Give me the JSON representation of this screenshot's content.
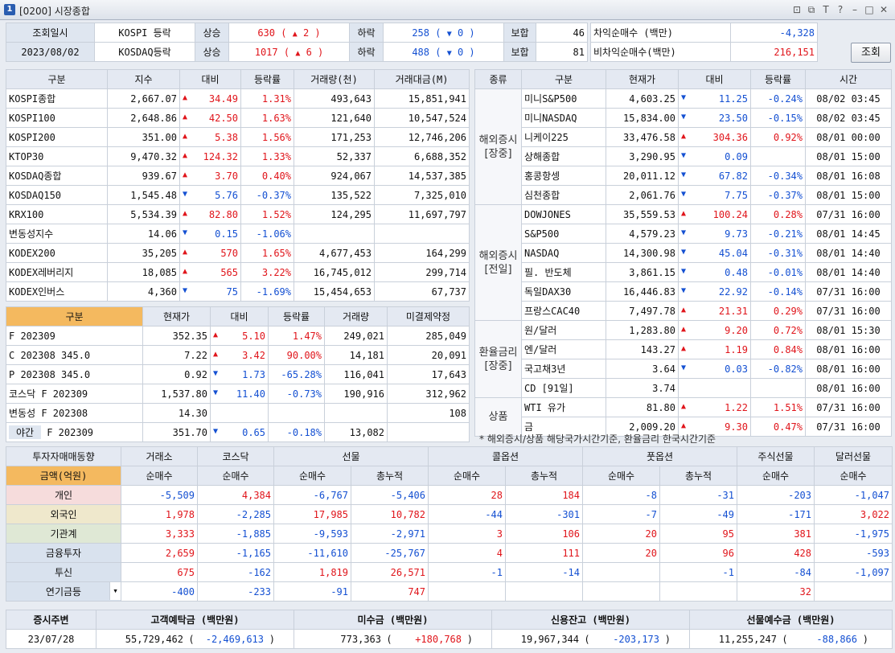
{
  "window": {
    "title": "[0200] 시장종합",
    "app_icon": "1"
  },
  "topbar": {
    "query_date_label": "조회일시",
    "query_date": "2023/08/02",
    "rows": [
      {
        "name": "KOSPI 등락",
        "up_label": "상승",
        "up": "630",
        "up_lim": "2",
        "down_label": "하락",
        "down": "258",
        "down_lim": "0",
        "flat_label": "보합",
        "flat": "46"
      },
      {
        "name": "KOSDAQ등락",
        "up_label": "상승",
        "up": "1017",
        "up_lim": "6",
        "down_label": "하락",
        "down": "488",
        "down_lim": "0",
        "flat_label": "보합",
        "flat": "81"
      }
    ],
    "arb": [
      {
        "label": "차익순매수 (백만)",
        "value": "-4,328"
      },
      {
        "label": "비차익순매수(백만)",
        "value": "216,151"
      }
    ],
    "search_button": "조회"
  },
  "domestic": {
    "headers": [
      "구분",
      "지수",
      "대비",
      "등락률",
      "거래량(천)",
      "거래대금(M)"
    ],
    "rows": [
      {
        "name": "KOSPI종합",
        "index": "2,667.07",
        "dir": "up",
        "chg": "34.49",
        "rate": "1.31%",
        "vol": "493,643",
        "amt": "15,851,941"
      },
      {
        "name": "KOSPI100",
        "index": "2,648.86",
        "dir": "up",
        "chg": "42.50",
        "rate": "1.63%",
        "vol": "121,640",
        "amt": "10,547,524"
      },
      {
        "name": "KOSPI200",
        "index": "351.00",
        "dir": "up",
        "chg": "5.38",
        "rate": "1.56%",
        "vol": "171,253",
        "amt": "12,746,206"
      },
      {
        "name": "KTOP30",
        "index": "9,470.32",
        "dir": "up",
        "chg": "124.32",
        "rate": "1.33%",
        "vol": "52,337",
        "amt": "6,688,352"
      },
      {
        "name": "KOSDAQ종합",
        "index": "939.67",
        "dir": "up",
        "chg": "3.70",
        "rate": "0.40%",
        "vol": "924,067",
        "amt": "14,537,385"
      },
      {
        "name": "KOSDAQ150",
        "index": "1,545.48",
        "dir": "dn",
        "chg": "5.76",
        "rate": "-0.37%",
        "vol": "135,522",
        "amt": "7,325,010"
      },
      {
        "name": "KRX100",
        "index": "5,534.39",
        "dir": "up",
        "chg": "82.80",
        "rate": "1.52%",
        "vol": "124,295",
        "amt": "11,697,797"
      },
      {
        "name": "변동성지수",
        "index": "14.06",
        "dir": "dn",
        "chg": "0.15",
        "rate": "-1.06%",
        "vol": "",
        "amt": ""
      },
      {
        "name": "KODEX200",
        "index": "35,205",
        "dir": "up",
        "chg": "570",
        "rate": "1.65%",
        "vol": "4,677,453",
        "amt": "164,299"
      },
      {
        "name": "KODEX레버리지",
        "index": "18,085",
        "dir": "up",
        "chg": "565",
        "rate": "3.22%",
        "vol": "16,745,012",
        "amt": "299,714"
      },
      {
        "name": "KODEX인버스",
        "index": "4,360",
        "dir": "dn",
        "chg": "75",
        "rate": "-1.69%",
        "vol": "15,454,653",
        "amt": "67,737"
      }
    ]
  },
  "futures": {
    "headers": [
      "구분",
      "현재가",
      "대비",
      "등락률",
      "거래량",
      "미결제약정"
    ],
    "rows": [
      {
        "name": "F 202309",
        "price": "352.35",
        "dir": "up",
        "chg": "5.10",
        "rate": "1.47%",
        "vol": "249,021",
        "oi": "285,049"
      },
      {
        "name": "C 202308 345.0",
        "price": "7.22",
        "dir": "up",
        "chg": "3.42",
        "rate": "90.00%",
        "vol": "14,181",
        "oi": "20,091"
      },
      {
        "name": "P 202308 345.0",
        "price": "0.92",
        "dir": "dn",
        "chg": "1.73",
        "rate": "-65.28%",
        "vol": "116,041",
        "oi": "17,643"
      },
      {
        "name": "코스닥 F 202309",
        "price": "1,537.80",
        "dir": "dn",
        "chg": "11.40",
        "rate": "-0.73%",
        "vol": "190,916",
        "oi": "312,962"
      },
      {
        "name": "변동성 F 202308",
        "price": "14.30",
        "dir": "",
        "chg": "",
        "rate": "",
        "vol": "",
        "oi": "108"
      }
    ],
    "night": {
      "label": "야간",
      "name": "F 202309",
      "price": "351.70",
      "dir": "dn",
      "chg": "0.65",
      "rate": "-0.18%",
      "vol": "13,082"
    }
  },
  "world": {
    "headers": [
      "종류",
      "구분",
      "현재가",
      "대비",
      "등락률",
      "시간"
    ],
    "groups": [
      {
        "cat": "해외증시[장중]",
        "rows": [
          {
            "name": "미니S&P500",
            "price": "4,603.25",
            "dir": "dn",
            "chg": "11.25",
            "rate": "-0.24%",
            "time": "08/02 03:45"
          },
          {
            "name": "미니NASDAQ",
            "price": "15,834.00",
            "dir": "dn",
            "chg": "23.50",
            "rate": "-0.15%",
            "time": "08/02 03:45"
          },
          {
            "name": "니케이225",
            "price": "33,476.58",
            "dir": "up",
            "chg": "304.36",
            "rate": "0.92%",
            "time": "08/01 00:00"
          },
          {
            "name": "상해종합",
            "price": "3,290.95",
            "dir": "dn",
            "chg": "0.09",
            "rate": "",
            "time": "08/01 15:00"
          },
          {
            "name": "홍콩항셍",
            "price": "20,011.12",
            "dir": "dn",
            "chg": "67.82",
            "rate": "-0.34%",
            "time": "08/01 16:08"
          },
          {
            "name": "심천종합",
            "price": "2,061.76",
            "dir": "dn",
            "chg": "7.75",
            "rate": "-0.37%",
            "time": "08/01 15:00"
          }
        ]
      },
      {
        "cat": "해외증시[전일]",
        "rows": [
          {
            "name": "DOWJONES",
            "price": "35,559.53",
            "dir": "up",
            "chg": "100.24",
            "rate": "0.28%",
            "time": "07/31 16:00"
          },
          {
            "name": "S&P500",
            "price": "4,579.23",
            "dir": "dn",
            "chg": "9.73",
            "rate": "-0.21%",
            "time": "08/01 14:45"
          },
          {
            "name": "NASDAQ",
            "price": "14,300.98",
            "dir": "dn",
            "chg": "45.04",
            "rate": "-0.31%",
            "time": "08/01 14:40"
          },
          {
            "name": "필. 반도체",
            "price": "3,861.15",
            "dir": "dn",
            "chg": "0.48",
            "rate": "-0.01%",
            "time": "08/01 14:40"
          },
          {
            "name": "독일DAX30",
            "price": "16,446.83",
            "dir": "dn",
            "chg": "22.92",
            "rate": "-0.14%",
            "time": "07/31 16:00"
          },
          {
            "name": "프랑스CAC40",
            "price": "7,497.78",
            "dir": "up",
            "chg": "21.31",
            "rate": "0.29%",
            "time": "07/31 16:00"
          }
        ]
      },
      {
        "cat": "환율금리[장중]",
        "rows": [
          {
            "name": "원/달러",
            "price": "1,283.80",
            "dir": "up",
            "chg": "9.20",
            "rate": "0.72%",
            "time": "08/01 15:30"
          },
          {
            "name": "엔/달러",
            "price": "143.27",
            "dir": "up",
            "chg": "1.19",
            "rate": "0.84%",
            "time": "08/01 16:00"
          },
          {
            "name": "국고채3년",
            "price": "3.64",
            "dir": "dn",
            "chg": "0.03",
            "rate": "-0.82%",
            "time": "08/01 16:00"
          },
          {
            "name": "CD [91일]",
            "price": "3.74",
            "dir": "",
            "chg": "",
            "rate": "",
            "time": "08/01 16:00"
          }
        ]
      },
      {
        "cat": "상품",
        "rows": [
          {
            "name": "WTI 유가",
            "price": "81.80",
            "dir": "up",
            "chg": "1.22",
            "rate": "1.51%",
            "time": "07/31 16:00"
          },
          {
            "name": "금",
            "price": "2,009.20",
            "dir": "up",
            "chg": "9.30",
            "rate": "0.47%",
            "time": "07/31 16:00"
          }
        ]
      }
    ],
    "note": "* 해외증시/상품 해당국가시간기준, 환율금리 한국시간기준"
  },
  "investor": {
    "title": "투자자매매동향",
    "unit": "금액(억원)",
    "groups": [
      "거래소",
      "코스닥",
      "선물",
      "콜옵션",
      "풋옵션",
      "주식선물",
      "달러선물"
    ],
    "sub": [
      "순매수",
      "순매수",
      "순매수",
      "총누적",
      "순매수",
      "총누적",
      "순매수",
      "총누적",
      "순매수",
      "순매수"
    ],
    "rows": [
      {
        "name": "개인",
        "vals": [
          "-5,509",
          "4,384",
          "-6,767",
          "-5,406",
          "28",
          "184",
          "-8",
          "-31",
          "-203",
          "-1,047"
        ]
      },
      {
        "name": "외국인",
        "vals": [
          "1,978",
          "-2,285",
          "17,985",
          "10,782",
          "-44",
          "-301",
          "-7",
          "-49",
          "-171",
          "3,022"
        ]
      },
      {
        "name": "기관계",
        "vals": [
          "3,333",
          "-1,885",
          "-9,593",
          "-2,971",
          "3",
          "106",
          "20",
          "95",
          "381",
          "-1,975"
        ]
      },
      {
        "name": "금융투자",
        "vals": [
          "2,659",
          "-1,165",
          "-11,610",
          "-25,767",
          "4",
          "111",
          "20",
          "96",
          "428",
          "-593"
        ]
      },
      {
        "name": "투신",
        "vals": [
          "675",
          "-162",
          "1,819",
          "26,571",
          "-1",
          "-14",
          "",
          "-1",
          "-84",
          "-1,097"
        ]
      },
      {
        "name": "연기금등",
        "vals": [
          "-400",
          "-233",
          "-91",
          "747",
          "",
          "",
          "",
          "",
          "32",
          ""
        ]
      }
    ]
  },
  "bottom": {
    "headers": [
      "증시주변",
      "고객예탁금 (백만원)",
      "미수금 (백만원)",
      "신용잔고 (백만원)",
      "선물예수금 (백만원)"
    ],
    "date": "23/07/28",
    "items": [
      {
        "value": "55,729,462",
        "chg": "-2,469,613",
        "color": "blue"
      },
      {
        "value": "773,363",
        "chg": "+180,768",
        "color": "red"
      },
      {
        "value": "19,967,344",
        "chg": "-203,173",
        "color": "blue"
      },
      {
        "value": "11,255,247",
        "chg": "-88,866",
        "color": "blue"
      }
    ]
  }
}
